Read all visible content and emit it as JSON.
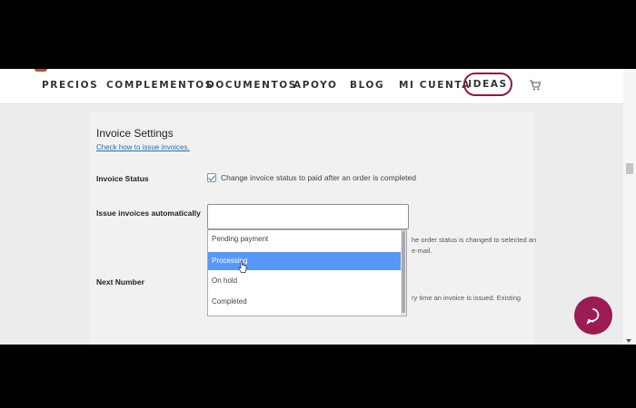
{
  "nav": {
    "items": [
      "PRECIOS",
      "COMPLEMENTOS",
      "DOCUMENTOS",
      "APOYO",
      "BLOG",
      "MI CUENTA"
    ],
    "ideas": "IDEAS",
    "cart_icon": "cart-icon"
  },
  "settings": {
    "title": "Invoice Settings",
    "help_link": "Check how to issue invoices.",
    "invoice_status": {
      "label": "Invoice Status",
      "checked": true,
      "text": "Change invoice status to paid after an order is completed"
    },
    "issue_auto": {
      "label": "Issue invoices automatically",
      "desc_line1": "he order status is changed to selected an",
      "desc_line2": "e-mail.",
      "options": [
        "Pending payment",
        "Processing",
        "On hold",
        "Completed"
      ],
      "highlighted": "Processing"
    },
    "next_number": {
      "label": "Next Number",
      "desc": "ry time an invoice is issued. Existing"
    }
  },
  "colors": {
    "accent": "#8a1a4a",
    "chat": "#9b1b55",
    "link": "#2271b1",
    "highlight": "#5897fb"
  },
  "chat_icon": "chat-bubble-icon"
}
